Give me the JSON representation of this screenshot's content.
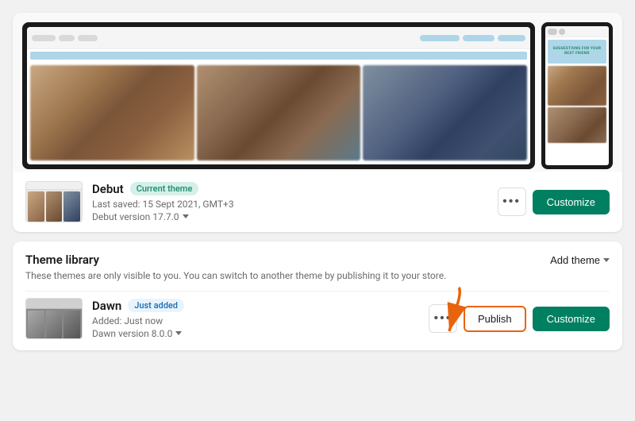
{
  "currentTheme": {
    "name": "Debut",
    "badge": "Current theme",
    "lastSaved": "Last saved: 15 Sept 2021, GMT+3",
    "version": "Debut version 17.7.0",
    "customizeLabel": "Customize",
    "moreLabel": "•••"
  },
  "library": {
    "title": "Theme library",
    "subtitle": "These themes are only visible to you. You can switch to another theme by publishing it to your store.",
    "addThemeLabel": "Add theme",
    "themes": [
      {
        "name": "Dawn",
        "badge": "Just added",
        "added": "Added: Just now",
        "version": "Dawn version 8.0.0",
        "publishLabel": "Publish",
        "customizeLabel": "Customize"
      }
    ]
  },
  "preview": {
    "mobileBannerText": "SUGGESTIONS FOR YOUR\nBEST FRIEND"
  }
}
